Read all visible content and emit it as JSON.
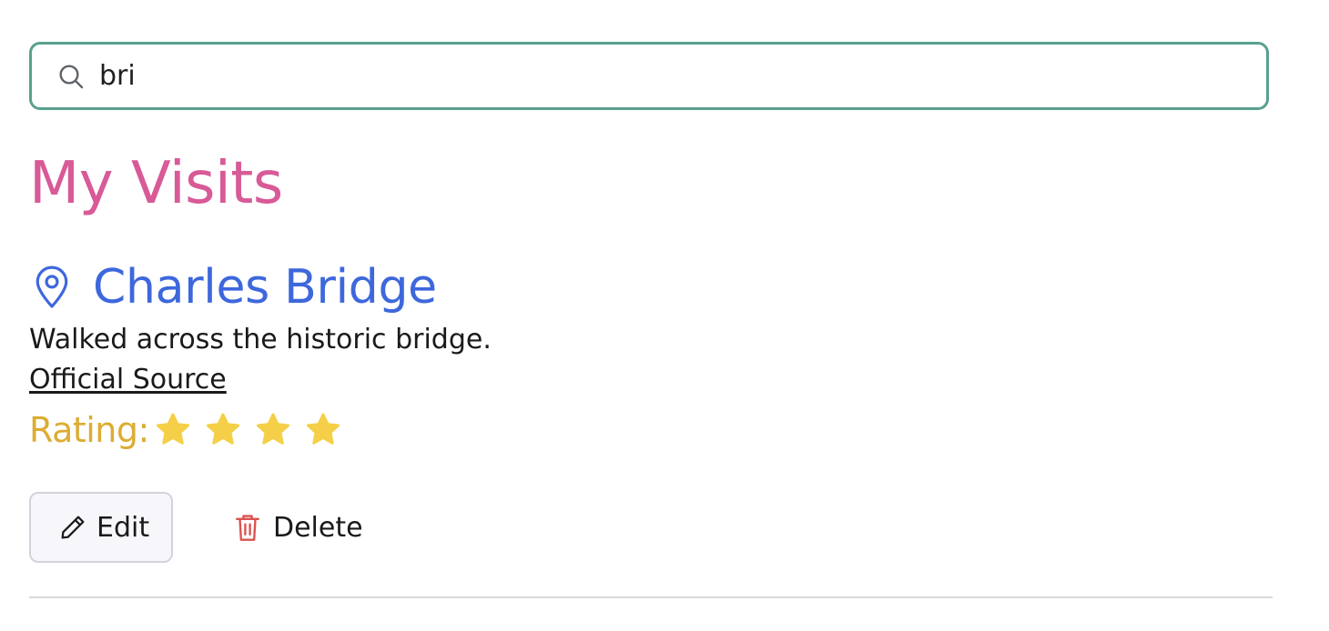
{
  "search": {
    "value": "bri",
    "icon": "search-icon"
  },
  "page": {
    "title": "My Visits"
  },
  "visit": {
    "icon": "map-pin-icon",
    "title": "Charles Bridge",
    "description": "Walked across the historic bridge.",
    "link_label": "Official Source",
    "rating_label": "Rating:",
    "rating_value": 4,
    "star_icon": "star-icon",
    "edit_label": "Edit",
    "edit_icon": "pencil-icon",
    "delete_label": "Delete",
    "delete_icon": "trash-icon"
  },
  "colors": {
    "search_border": "#5aa08f",
    "title": "#d85a97",
    "visit_title": "#3d67dc",
    "rating": "#dcad33",
    "star": "#f5cf47",
    "delete_icon": "#d9534f"
  }
}
